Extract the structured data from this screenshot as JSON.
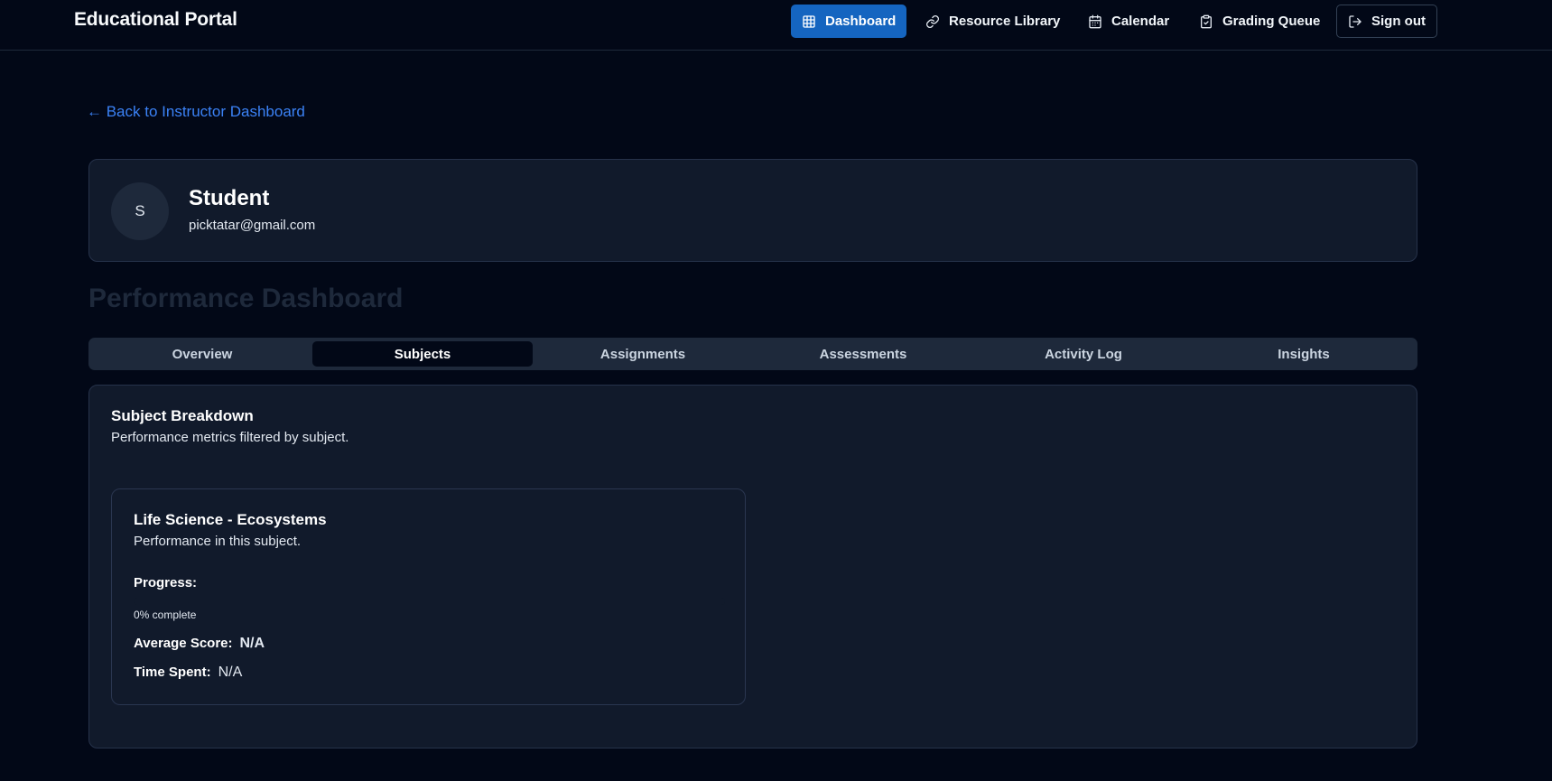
{
  "header": {
    "brand": "Educational Portal",
    "nav": [
      {
        "label": "Dashboard",
        "icon": "grid-icon",
        "active": true
      },
      {
        "label": "Resource Library",
        "icon": "link-icon"
      },
      {
        "label": "Calendar",
        "icon": "calendar-icon"
      },
      {
        "label": "Grading Queue",
        "icon": "clipboard-check-icon"
      },
      {
        "label": "Sign out",
        "icon": "sign-out-icon"
      }
    ]
  },
  "back_link": "← Back to Instructor Dashboard",
  "profile": {
    "avatar_initial": "S",
    "name": "Student",
    "email": "picktatar@gmail.com"
  },
  "page_title": "Performance Dashboard",
  "tabs": [
    {
      "label": "Overview"
    },
    {
      "label": "Subjects",
      "active": true
    },
    {
      "label": "Assignments"
    },
    {
      "label": "Assessments"
    },
    {
      "label": "Activity Log"
    },
    {
      "label": "Insights"
    }
  ],
  "subject_breakdown": {
    "title": "Subject Breakdown",
    "subtitle": "Performance metrics filtered by subject.",
    "subjects": [
      {
        "name": "Life Science - Ecosystems",
        "subtitle": "Performance in this subject.",
        "progress_label": "Progress:",
        "progress_fraction": 0,
        "progress_text": "0% complete",
        "avg_score_label": "Average Score:",
        "avg_score_value": "N/A",
        "time_spent_label": "Time Spent:",
        "time_spent_value": "N/A"
      }
    ]
  },
  "colors": {
    "background": "#020817",
    "accent": "#1565c0",
    "link": "#3b82f6",
    "card": "#111a2b"
  }
}
